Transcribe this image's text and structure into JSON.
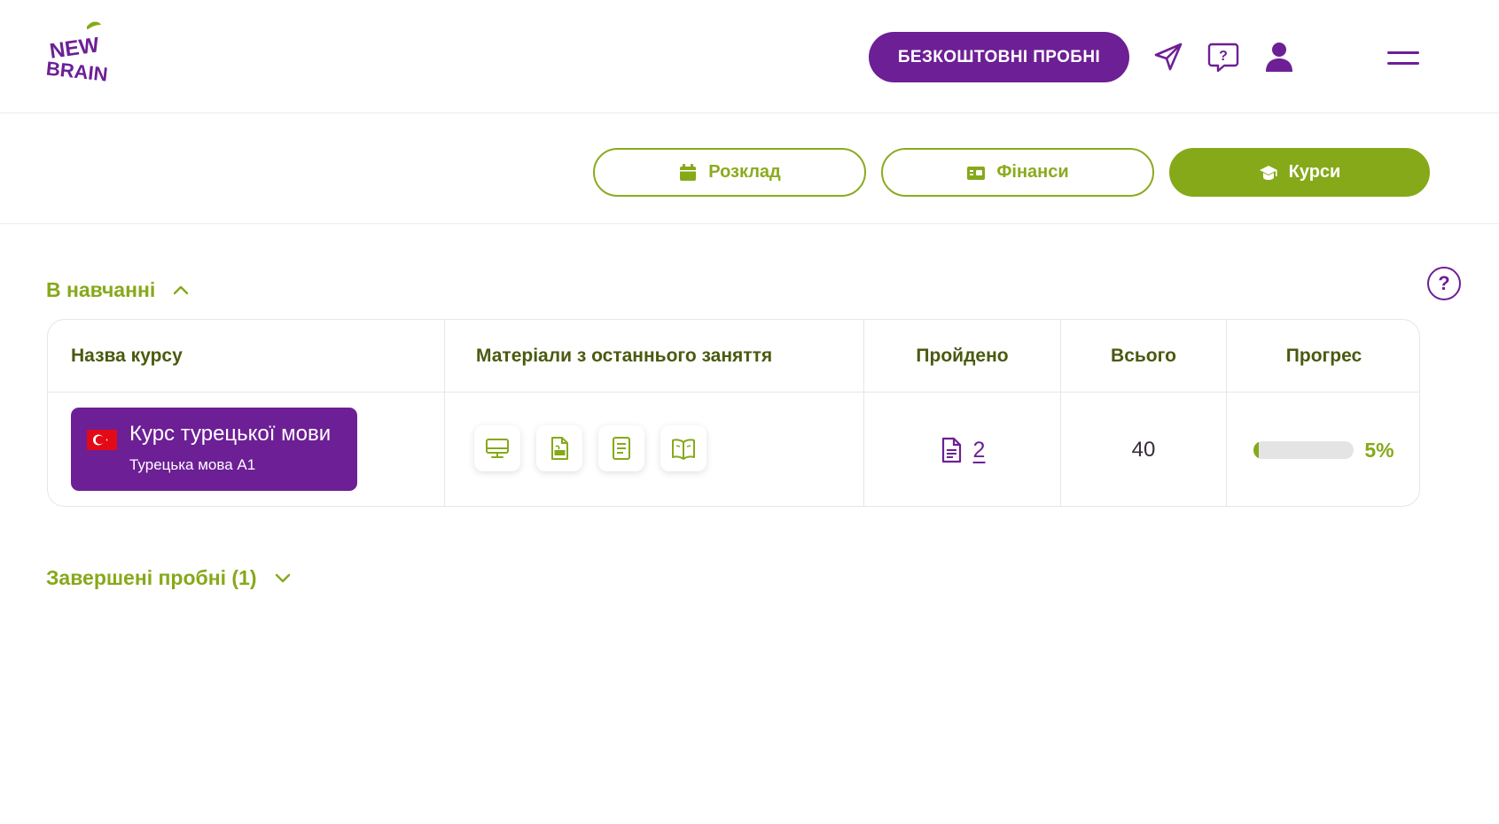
{
  "header": {
    "logo_text": [
      "NEW",
      "BRAIN"
    ],
    "trial_button": "БЕЗКОШТОВНІ ПРОБНІ",
    "icons": [
      "send-icon",
      "chat-help-icon",
      "user-icon",
      "menu-icon"
    ]
  },
  "tabs": [
    {
      "label": "Розклад",
      "icon": "calendar-icon",
      "active": false
    },
    {
      "label": "Фінанси",
      "icon": "wallet-icon",
      "active": false
    },
    {
      "label": "Курси",
      "icon": "graduation-cap-icon",
      "active": true
    }
  ],
  "in_study": {
    "title": "В навчанні",
    "help": "?",
    "columns": {
      "course": "Назва курсу",
      "materials": "Матеріали з останнього заняття",
      "passed": "Пройдено",
      "total": "Всього",
      "progress": "Прогрес"
    },
    "rows": [
      {
        "course_name": "Курс турецької мови",
        "course_level": "Турецька мова А1",
        "flag": "turkey-flag",
        "materials": [
          "presentation-icon",
          "pdf-icon",
          "notes-icon",
          "book-icon"
        ],
        "passed": "2",
        "total": "40",
        "progress_percent": 5,
        "progress_text": "5%"
      }
    ]
  },
  "completed_trials": {
    "title": "Завершені пробні (1)"
  },
  "colors": {
    "purple": "#6d1f95",
    "green": "#86a91a",
    "dark_green_text": "#4a5a10"
  }
}
